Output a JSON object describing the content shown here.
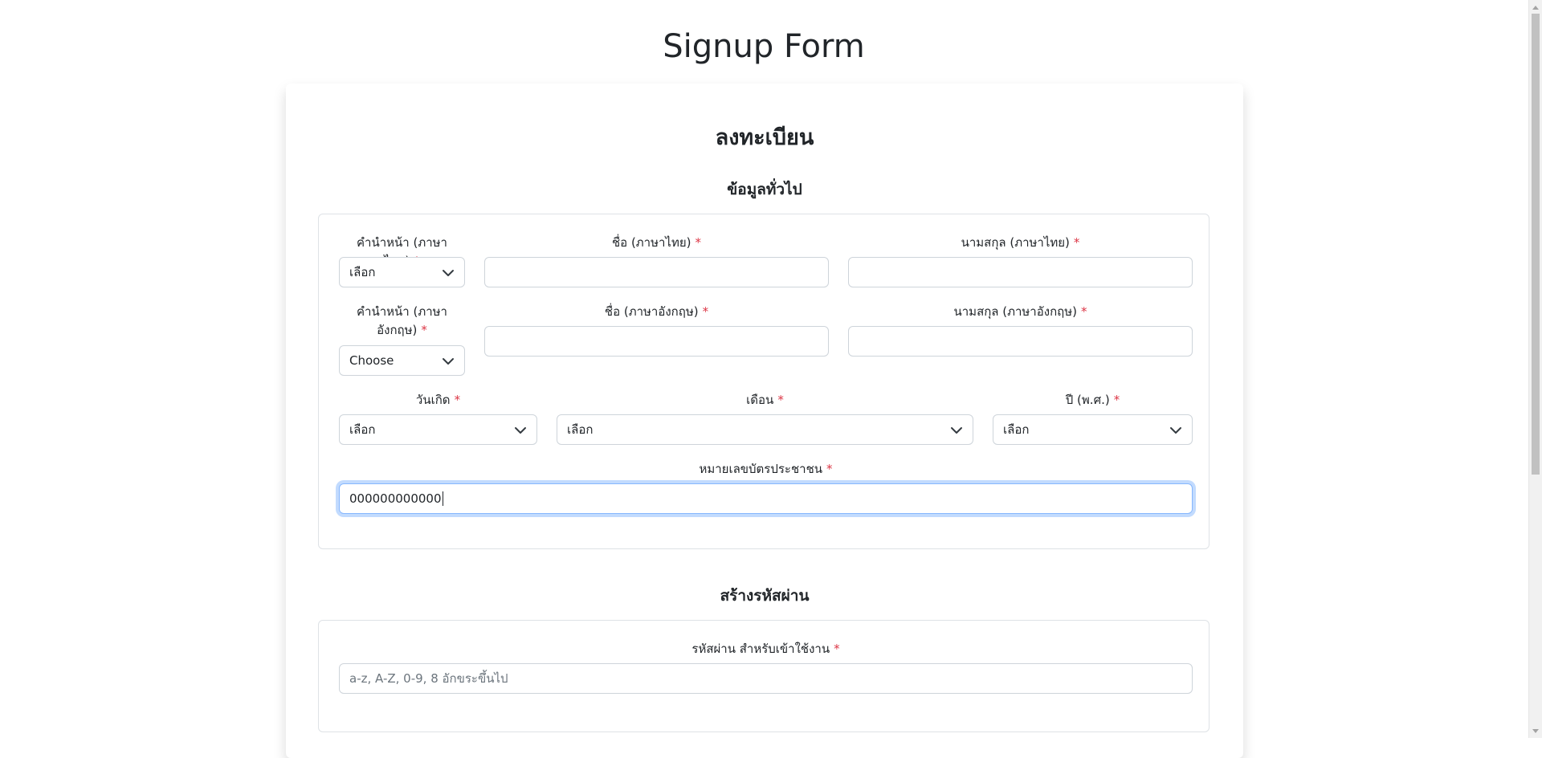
{
  "page": {
    "title": "Signup Form"
  },
  "form": {
    "heading": "ลงทะเบียน",
    "general": {
      "heading": "ข้อมูลทั่วไป",
      "title_th": {
        "label": "คำนำหน้า (ภาษาไทย)",
        "value": "เลือก"
      },
      "first_name_th": {
        "label": "ชื่อ (ภาษาไทย)",
        "value": ""
      },
      "last_name_th": {
        "label": "นามสกุล (ภาษาไทย)",
        "value": ""
      },
      "title_en": {
        "label_line1": "คำนำหน้า (ภาษา",
        "label_line2": "อังกฤษ)",
        "value": "Choose"
      },
      "first_name_en": {
        "label": "ชื่อ (ภาษาอังกฤษ)",
        "value": ""
      },
      "last_name_en": {
        "label": "นามสกุล (ภาษาอังกฤษ)",
        "value": ""
      },
      "birth_day": {
        "label": "วันเกิด",
        "value": "เลือก"
      },
      "birth_month": {
        "label": "เดือน",
        "value": "เลือก"
      },
      "birth_year": {
        "label": "ปี (พ.ศ.)",
        "value": "เลือก"
      },
      "national_id": {
        "label": "หมายเลขบัตรประชาชน",
        "value": "000000000000"
      }
    },
    "password": {
      "heading": "สร้างรหัสผ่าน",
      "label": "รหัสผ่าน สำหรับเข้าใช้งาน",
      "placeholder": "a-z, A-Z, 0-9, 8 อักขระขึ้นไป"
    },
    "required_mark": "*"
  },
  "icons": {
    "chevron": "chevron-down-icon",
    "scroll_up": "scroll-up-arrow-icon",
    "scroll_down": "scroll-down-arrow-icon"
  },
  "colors": {
    "required": "#dc3545",
    "focus_border": "#86b7fe",
    "border": "#ced4da"
  }
}
